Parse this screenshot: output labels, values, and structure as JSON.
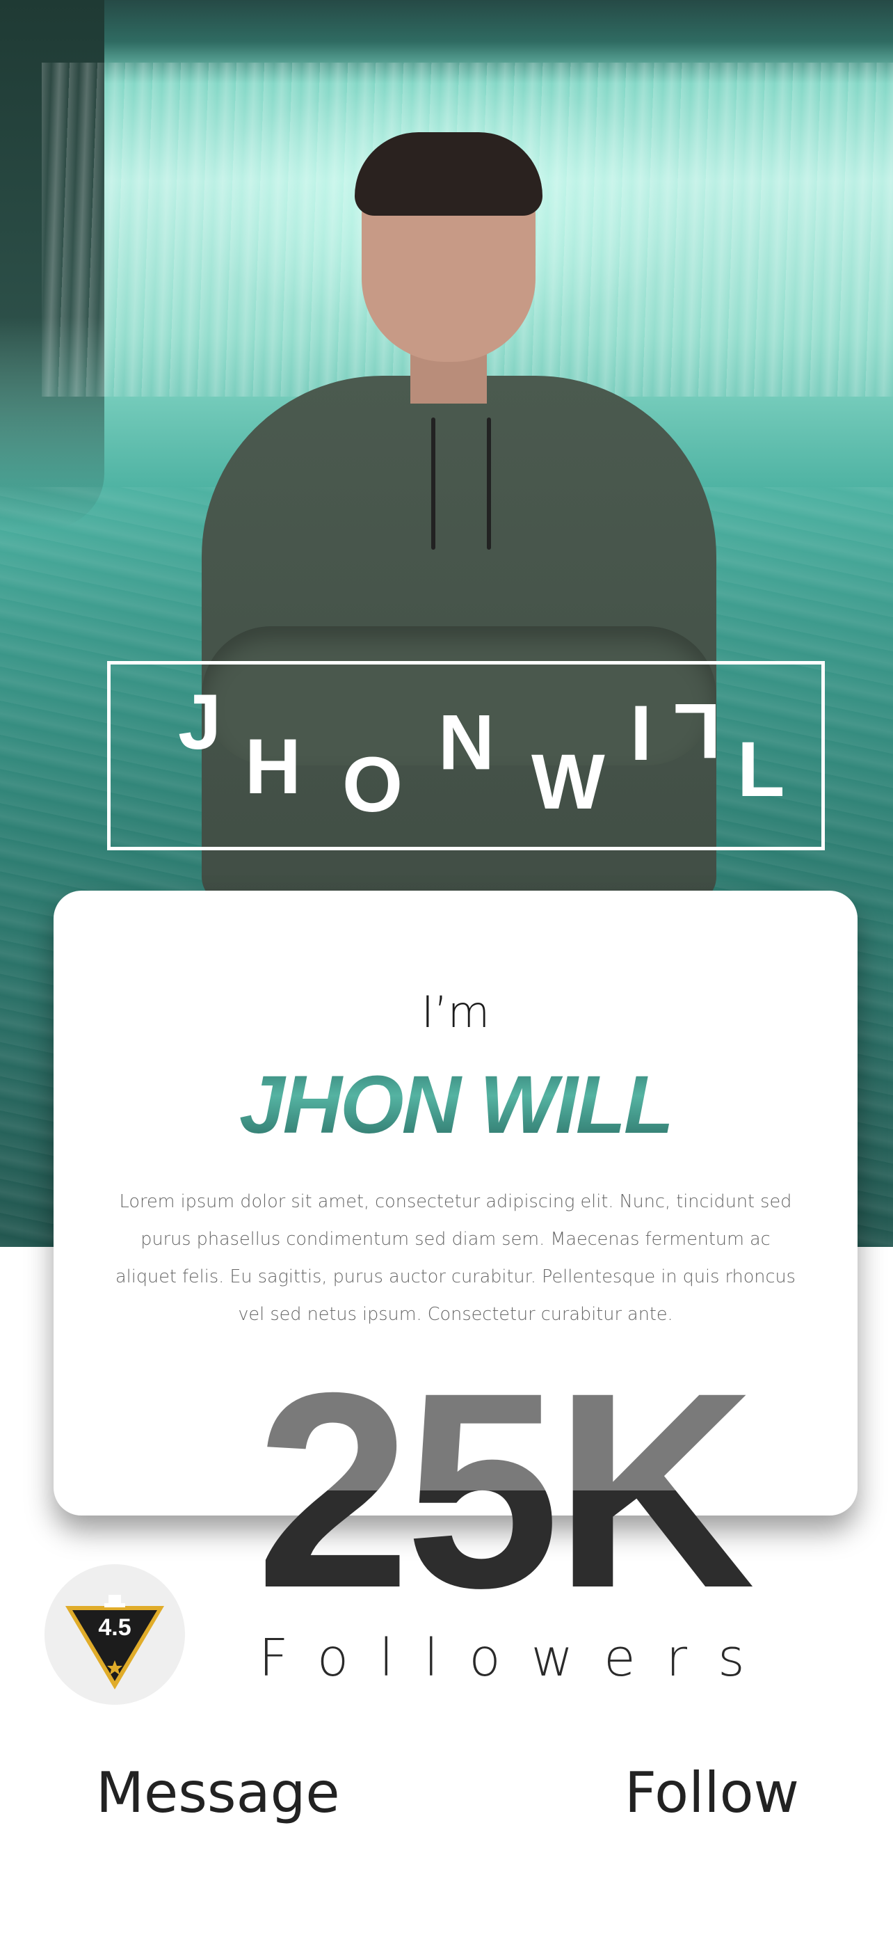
{
  "profile": {
    "frame_letters": [
      "J",
      "H",
      "O",
      "N",
      "W",
      "I",
      "L",
      "L"
    ],
    "greeting": "I’m",
    "name_first": "JHON",
    "name_last": "WILL",
    "bio": "Lorem ipsum dolor sit amet, consectetur adipiscing elit. Nunc, tincidunt sed purus phasellus condimentum sed diam sem. Maecenas fermentum ac aliquet felis. Eu sagittis, purus auctor curabitur. Pellentesque in quis rhoncus vel sed netus ipsum. Consectetur curabitur ante."
  },
  "stats": {
    "followers_count": "25K",
    "followers_label": "Followers",
    "rating": "4.5"
  },
  "actions": {
    "message_label": "Message",
    "follow_label": "Follow"
  },
  "colors": {
    "accent_teal": "#3e9a8c",
    "badge_gold": "#e0ac2a",
    "text_dark": "#222222"
  },
  "icons": {
    "badge_icon": "trophy-shield-icon",
    "star_icon": "star-icon"
  }
}
